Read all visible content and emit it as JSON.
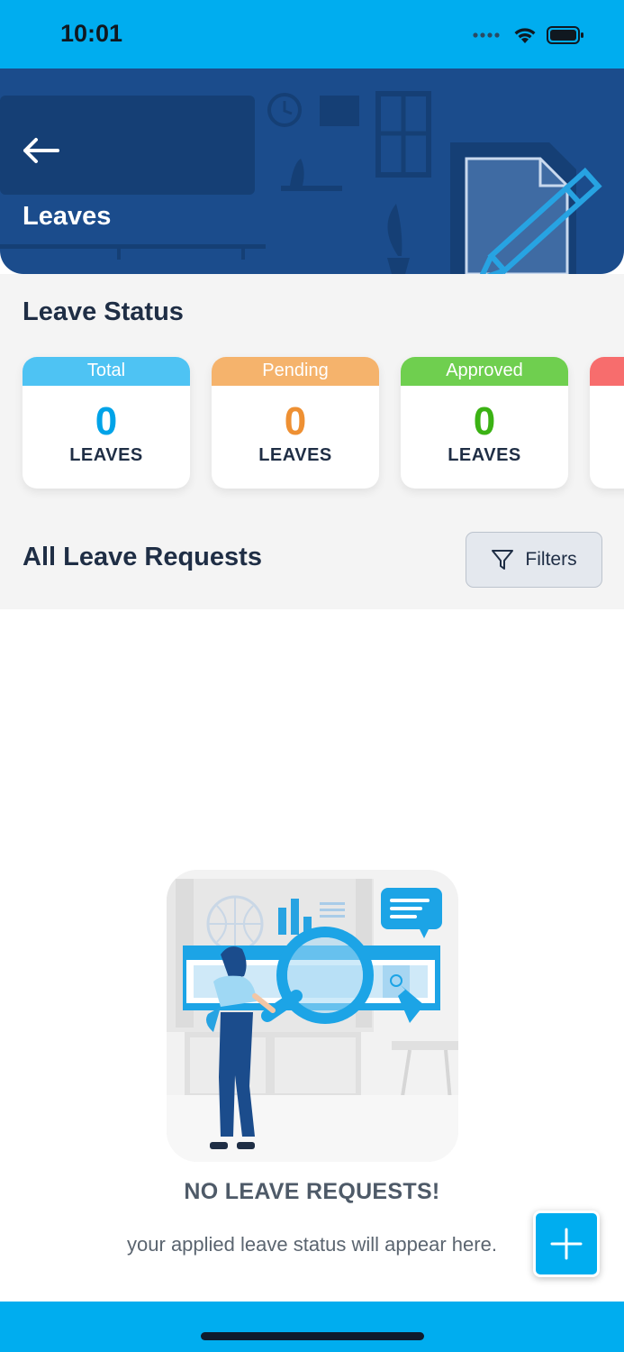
{
  "status_bar": {
    "time": "10:01",
    "icons": [
      "signal-icon",
      "wifi-icon",
      "battery-icon"
    ]
  },
  "header": {
    "title": "Leaves",
    "back_icon": "arrow-left-icon",
    "color": "#1b4c8c"
  },
  "leave_status": {
    "title": "Leave Status",
    "cards": [
      {
        "label": "Total",
        "count": "0",
        "unit": "LEAVES",
        "head_color": "#4ec3f3",
        "count_color": "#00a3e8"
      },
      {
        "label": "Pending",
        "count": "0",
        "unit": "LEAVES",
        "head_color": "#f5b36c",
        "count_color": "#ee9033"
      },
      {
        "label": "Approved",
        "count": "0",
        "unit": "LEAVES",
        "head_color": "#6fcf4f",
        "count_color": "#3bb214"
      },
      {
        "label": "",
        "count": "",
        "unit": "",
        "head_color": "#f76d6d",
        "count_color": "#e04848"
      }
    ]
  },
  "requests": {
    "title": "All Leave Requests",
    "filters_label": "Filters",
    "filter_icon": "funnel-icon"
  },
  "empty_state": {
    "title": "NO LEAVE REQUESTS!",
    "subtitle": "your applied leave status will appear here."
  },
  "fab": {
    "icon": "plus-icon"
  },
  "colors": {
    "accent": "#00adef",
    "text_dark": "#1f2e45",
    "section_bg": "#f4f4f4"
  }
}
